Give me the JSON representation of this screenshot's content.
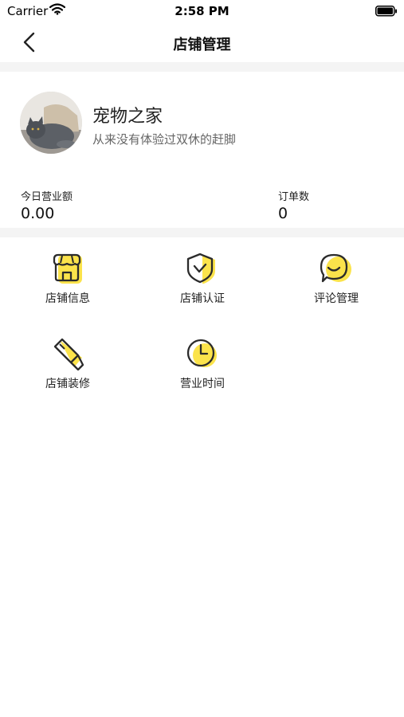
{
  "status_bar": {
    "carrier": "Carrier",
    "time": "2:58 PM"
  },
  "nav": {
    "title": "店铺管理"
  },
  "profile": {
    "name": "宠物之家",
    "motto": "从来没有体验过双休的赶脚"
  },
  "stats": {
    "revenue_label": "今日营业额",
    "revenue_value": "0.00",
    "orders_label": "订单数",
    "orders_value": "0"
  },
  "menu": [
    {
      "label": "店铺信息",
      "icon": "store-icon"
    },
    {
      "label": "店铺认证",
      "icon": "shield-check-icon"
    },
    {
      "label": "评论管理",
      "icon": "comment-bubble-icon"
    },
    {
      "label": "店铺装修",
      "icon": "paint-brush-icon"
    },
    {
      "label": "营业时间",
      "icon": "clock-icon"
    }
  ],
  "colors": {
    "accent_yellow": "#FBE34B",
    "icon_stroke": "#2b2b2b",
    "divider": "#f4f4f4"
  }
}
